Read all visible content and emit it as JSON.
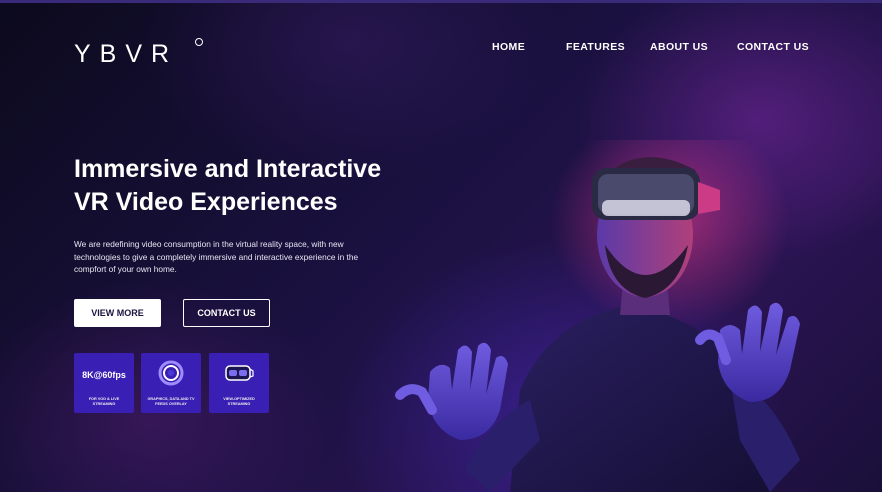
{
  "brand": {
    "logo_text": "YBVR"
  },
  "nav": {
    "home": "HOME",
    "features": "FEATURES",
    "about": "ABOUT US",
    "contact": "CONTACT US"
  },
  "hero": {
    "title_line1": "Immersive and Interactive",
    "title_line2": "VR Video Experiences",
    "description": "We are redefining video consumption in the virtual reality space, with new technologies to give a completely immersive and interactive experience in the compfort of your own home.",
    "view_more": "VIEW MORE",
    "contact_us": "CONTACT US"
  },
  "features": [
    {
      "title": "8K@60fps",
      "caption": "FOR VOD & LIVE STREAMING",
      "icon": "8k-badge"
    },
    {
      "title": "",
      "caption": "GRAPHICS, DATA AND TV FEEDS OVERLAY",
      "icon": "ring-icon"
    },
    {
      "title": "",
      "caption": "VIEW-OPTIMIZED STREAMING",
      "icon": "vr-headset-icon"
    }
  ],
  "colors": {
    "background": "#0d0a1f",
    "card": "#3a1fb5",
    "accent_magenta": "#c0337a",
    "accent_blue": "#4a3bd8"
  }
}
